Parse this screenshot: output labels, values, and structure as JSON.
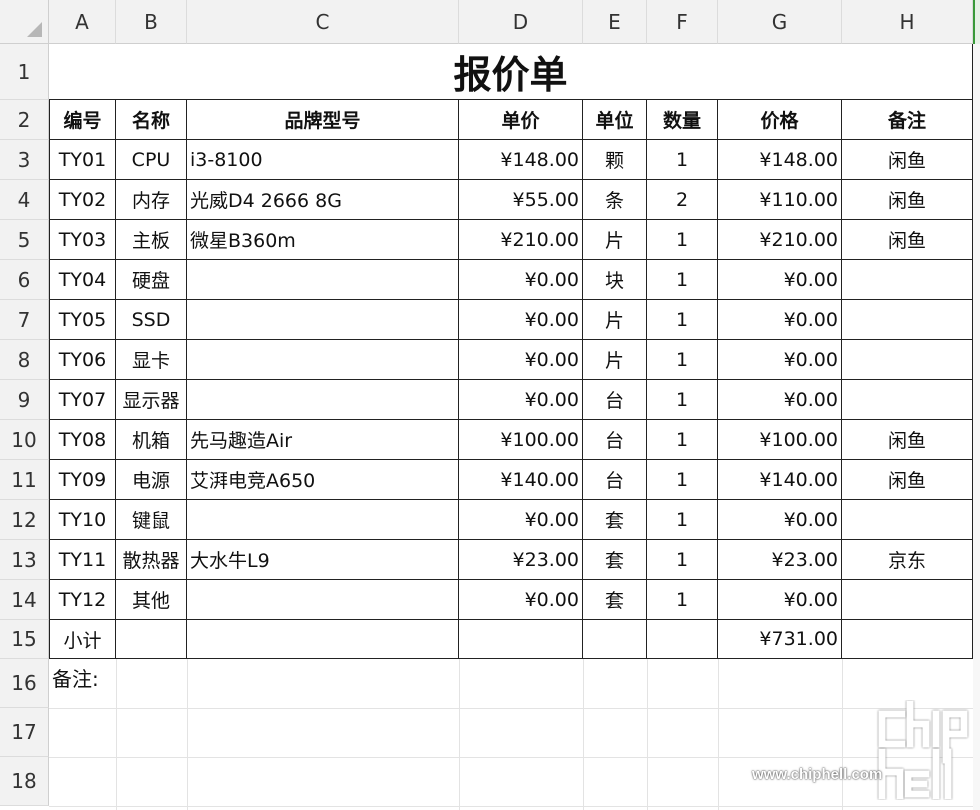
{
  "columns": [
    "A",
    "B",
    "C",
    "D",
    "E",
    "F",
    "G",
    "H"
  ],
  "rows": [
    "1",
    "2",
    "3",
    "4",
    "5",
    "6",
    "7",
    "8",
    "9",
    "10",
    "11",
    "12",
    "13",
    "14",
    "15",
    "16",
    "17",
    "18"
  ],
  "title": "报价单",
  "headers": [
    "编号",
    "名称",
    "品牌型号",
    "单价",
    "单位",
    "数量",
    "价格",
    "备注"
  ],
  "items": [
    [
      "TY01",
      "CPU",
      "i3-8100",
      "¥148.00",
      "颗",
      "1",
      "¥148.00",
      "闲鱼"
    ],
    [
      "TY02",
      "内存",
      "光威D4 2666 8G",
      "¥55.00",
      "条",
      "2",
      "¥110.00",
      "闲鱼"
    ],
    [
      "TY03",
      "主板",
      "微星B360m",
      "¥210.00",
      "片",
      "1",
      "¥210.00",
      "闲鱼"
    ],
    [
      "TY04",
      "硬盘",
      "",
      "¥0.00",
      "块",
      "1",
      "¥0.00",
      ""
    ],
    [
      "TY05",
      "SSD",
      "",
      "¥0.00",
      "片",
      "1",
      "¥0.00",
      ""
    ],
    [
      "TY06",
      "显卡",
      "",
      "¥0.00",
      "片",
      "1",
      "¥0.00",
      ""
    ],
    [
      "TY07",
      "显示器",
      "",
      "¥0.00",
      "台",
      "1",
      "¥0.00",
      ""
    ],
    [
      "TY08",
      "机箱",
      "先马趣造Air",
      "¥100.00",
      "台",
      "1",
      "¥100.00",
      "闲鱼"
    ],
    [
      "TY09",
      "电源",
      "艾湃电竞A650",
      "¥140.00",
      "台",
      "1",
      "¥140.00",
      "闲鱼"
    ],
    [
      "TY10",
      "键鼠",
      "",
      "¥0.00",
      "套",
      "1",
      "¥0.00",
      ""
    ],
    [
      "TY11",
      "散热器",
      "大水牛L9",
      "¥23.00",
      "套",
      "1",
      "¥23.00",
      "京东"
    ],
    [
      "TY12",
      "其他",
      "",
      "¥0.00",
      "套",
      "1",
      "¥0.00",
      ""
    ]
  ],
  "subtotal": [
    "小计",
    "",
    "",
    "",
    "",
    "",
    "¥731.00",
    ""
  ],
  "note_label": "备注:",
  "watermark": {
    "logo": "chiphell",
    "url": "www.chiphell.com"
  }
}
